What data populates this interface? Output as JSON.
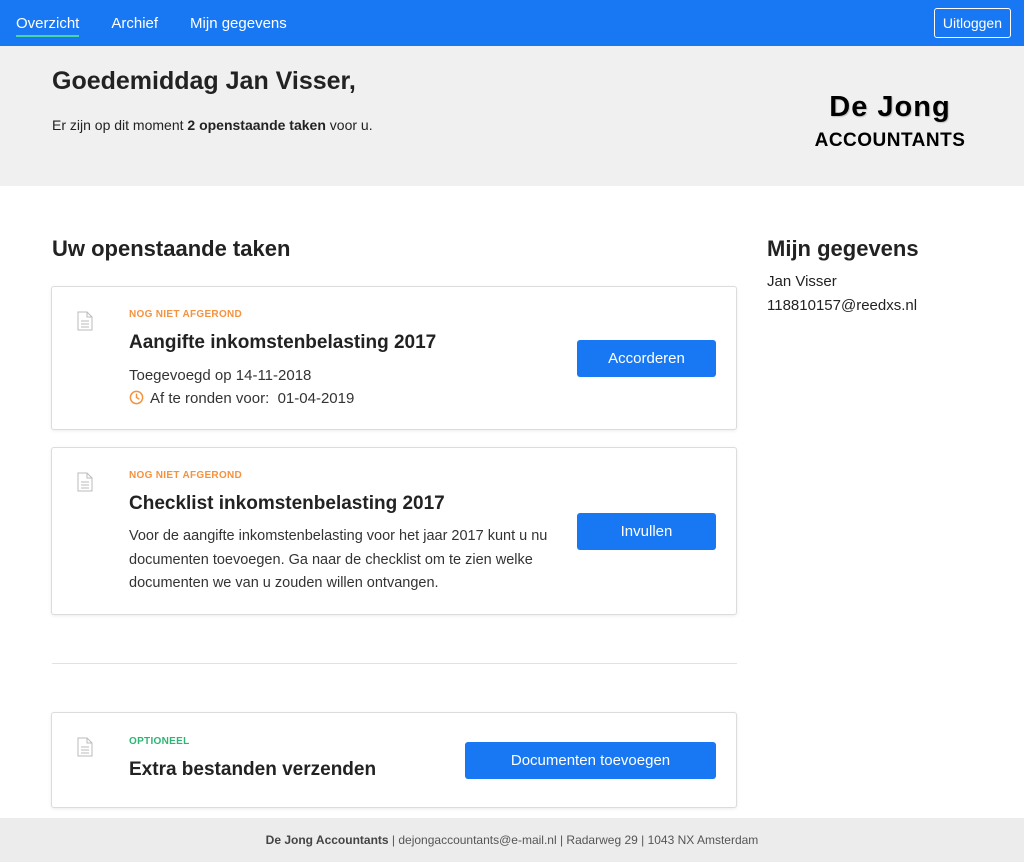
{
  "nav": {
    "items": [
      {
        "label": "Overzicht",
        "active": true
      },
      {
        "label": "Archief",
        "active": false
      },
      {
        "label": "Mijn gegevens",
        "active": false
      }
    ],
    "logout_label": "Uitloggen"
  },
  "hero": {
    "greeting": "Goedemiddag Jan Visser,",
    "sub_prefix": "Er zijn op dit moment ",
    "sub_bold": "2 openstaande taken",
    "sub_suffix": " voor u.",
    "logo_line1": "De Jong",
    "logo_line2": "ACCOUNTANTS"
  },
  "tasks_title": "Uw openstaande taken",
  "tasks": [
    {
      "status": "NOG NIET AFGEROND",
      "title": "Aangifte inkomstenbelasting 2017",
      "added": "Toegevoegd op 14-11-2018",
      "deadline_label": "Af te ronden voor:",
      "deadline_date": "01-04-2019",
      "button_label": "Accorderen"
    },
    {
      "status": "NOG NIET AFGEROND",
      "title": "Checklist inkomstenbelasting 2017",
      "description": "Voor de aangifte inkomstenbelasting voor het jaar 2017 kunt u nu documenten toevoegen. Ga naar de checklist om te zien welke documenten we van u zouden willen ontvangen.",
      "button_label": "Invullen"
    }
  ],
  "optional": {
    "status": "OPTIONEEL",
    "title": "Extra bestanden verzenden",
    "button_label": "Documenten toevoegen"
  },
  "profile": {
    "title": "Mijn gegevens",
    "name": "Jan Visser",
    "email": "118810157@reedxs.nl"
  },
  "footer": {
    "company": "De Jong Accountants",
    "rest": " | dejongaccountants@e-mail.nl | Radarweg 29 | 1043 NX Amsterdam"
  },
  "colors": {
    "primary": "#1877f2",
    "status_pending": "#f5923e",
    "status_optional": "#2bb673"
  }
}
